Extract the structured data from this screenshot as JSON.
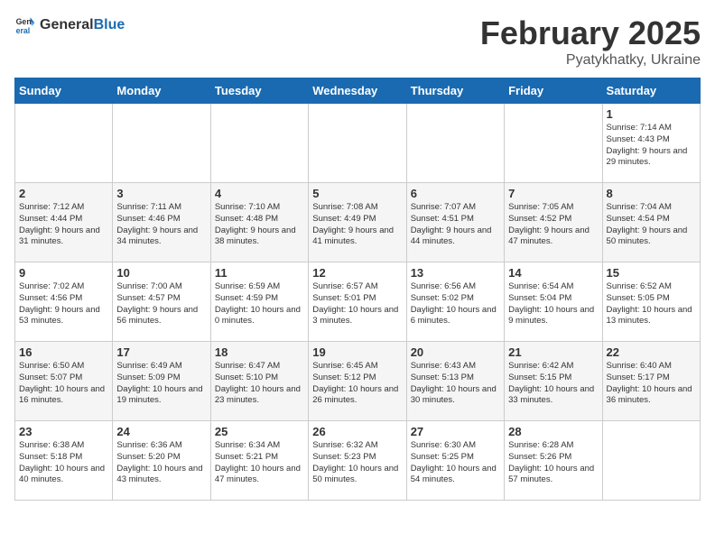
{
  "header": {
    "logo_general": "General",
    "logo_blue": "Blue",
    "title": "February 2025",
    "subtitle": "Pyatykhatky, Ukraine"
  },
  "weekdays": [
    "Sunday",
    "Monday",
    "Tuesday",
    "Wednesday",
    "Thursday",
    "Friday",
    "Saturday"
  ],
  "weeks": [
    [
      {
        "day": "",
        "info": ""
      },
      {
        "day": "",
        "info": ""
      },
      {
        "day": "",
        "info": ""
      },
      {
        "day": "",
        "info": ""
      },
      {
        "day": "",
        "info": ""
      },
      {
        "day": "",
        "info": ""
      },
      {
        "day": "1",
        "info": "Sunrise: 7:14 AM\nSunset: 4:43 PM\nDaylight: 9 hours and 29 minutes."
      }
    ],
    [
      {
        "day": "2",
        "info": "Sunrise: 7:12 AM\nSunset: 4:44 PM\nDaylight: 9 hours and 31 minutes."
      },
      {
        "day": "3",
        "info": "Sunrise: 7:11 AM\nSunset: 4:46 PM\nDaylight: 9 hours and 34 minutes."
      },
      {
        "day": "4",
        "info": "Sunrise: 7:10 AM\nSunset: 4:48 PM\nDaylight: 9 hours and 38 minutes."
      },
      {
        "day": "5",
        "info": "Sunrise: 7:08 AM\nSunset: 4:49 PM\nDaylight: 9 hours and 41 minutes."
      },
      {
        "day": "6",
        "info": "Sunrise: 7:07 AM\nSunset: 4:51 PM\nDaylight: 9 hours and 44 minutes."
      },
      {
        "day": "7",
        "info": "Sunrise: 7:05 AM\nSunset: 4:52 PM\nDaylight: 9 hours and 47 minutes."
      },
      {
        "day": "8",
        "info": "Sunrise: 7:04 AM\nSunset: 4:54 PM\nDaylight: 9 hours and 50 minutes."
      }
    ],
    [
      {
        "day": "9",
        "info": "Sunrise: 7:02 AM\nSunset: 4:56 PM\nDaylight: 9 hours and 53 minutes."
      },
      {
        "day": "10",
        "info": "Sunrise: 7:00 AM\nSunset: 4:57 PM\nDaylight: 9 hours and 56 minutes."
      },
      {
        "day": "11",
        "info": "Sunrise: 6:59 AM\nSunset: 4:59 PM\nDaylight: 10 hours and 0 minutes."
      },
      {
        "day": "12",
        "info": "Sunrise: 6:57 AM\nSunset: 5:01 PM\nDaylight: 10 hours and 3 minutes."
      },
      {
        "day": "13",
        "info": "Sunrise: 6:56 AM\nSunset: 5:02 PM\nDaylight: 10 hours and 6 minutes."
      },
      {
        "day": "14",
        "info": "Sunrise: 6:54 AM\nSunset: 5:04 PM\nDaylight: 10 hours and 9 minutes."
      },
      {
        "day": "15",
        "info": "Sunrise: 6:52 AM\nSunset: 5:05 PM\nDaylight: 10 hours and 13 minutes."
      }
    ],
    [
      {
        "day": "16",
        "info": "Sunrise: 6:50 AM\nSunset: 5:07 PM\nDaylight: 10 hours and 16 minutes."
      },
      {
        "day": "17",
        "info": "Sunrise: 6:49 AM\nSunset: 5:09 PM\nDaylight: 10 hours and 19 minutes."
      },
      {
        "day": "18",
        "info": "Sunrise: 6:47 AM\nSunset: 5:10 PM\nDaylight: 10 hours and 23 minutes."
      },
      {
        "day": "19",
        "info": "Sunrise: 6:45 AM\nSunset: 5:12 PM\nDaylight: 10 hours and 26 minutes."
      },
      {
        "day": "20",
        "info": "Sunrise: 6:43 AM\nSunset: 5:13 PM\nDaylight: 10 hours and 30 minutes."
      },
      {
        "day": "21",
        "info": "Sunrise: 6:42 AM\nSunset: 5:15 PM\nDaylight: 10 hours and 33 minutes."
      },
      {
        "day": "22",
        "info": "Sunrise: 6:40 AM\nSunset: 5:17 PM\nDaylight: 10 hours and 36 minutes."
      }
    ],
    [
      {
        "day": "23",
        "info": "Sunrise: 6:38 AM\nSunset: 5:18 PM\nDaylight: 10 hours and 40 minutes."
      },
      {
        "day": "24",
        "info": "Sunrise: 6:36 AM\nSunset: 5:20 PM\nDaylight: 10 hours and 43 minutes."
      },
      {
        "day": "25",
        "info": "Sunrise: 6:34 AM\nSunset: 5:21 PM\nDaylight: 10 hours and 47 minutes."
      },
      {
        "day": "26",
        "info": "Sunrise: 6:32 AM\nSunset: 5:23 PM\nDaylight: 10 hours and 50 minutes."
      },
      {
        "day": "27",
        "info": "Sunrise: 6:30 AM\nSunset: 5:25 PM\nDaylight: 10 hours and 54 minutes."
      },
      {
        "day": "28",
        "info": "Sunrise: 6:28 AM\nSunset: 5:26 PM\nDaylight: 10 hours and 57 minutes."
      },
      {
        "day": "",
        "info": ""
      }
    ]
  ]
}
